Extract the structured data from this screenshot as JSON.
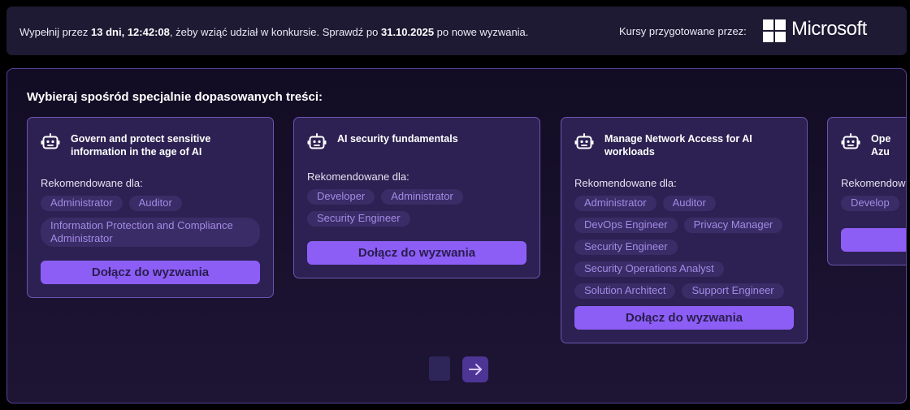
{
  "banner": {
    "text_prefix": "Wypełnij przez ",
    "countdown": "13 dni, 12:42:08",
    "text_middle": ", żeby wziąć udział w konkursie. Sprawdź po ",
    "date": "31.10.2025",
    "text_suffix": " po nowe wyzwania.",
    "courses_by": "Kursy przygotowane przez:",
    "brand": "Microsoft"
  },
  "section_title": "Wybieraj spośród specjalnie dopasowanych treści:",
  "rec_label": "Rekomendowane dla:",
  "join_label": "Dołącz do wyzwania",
  "cards": [
    {
      "title": "Govern and protect sensitive information in the age of AI",
      "tags": [
        "Administrator",
        "Auditor",
        "Information Protection and Compliance Administrator"
      ]
    },
    {
      "title": "AI security fundamentals",
      "tags": [
        "Developer",
        "Administrator",
        "Security Engineer"
      ]
    },
    {
      "title": "Manage Network Access for AI workloads",
      "tags": [
        "Administrator",
        "Auditor",
        "DevOps Engineer",
        "Privacy Manager",
        "Security Engineer",
        "Security Operations Analyst",
        "Solution Architect",
        "Support Engineer"
      ]
    },
    {
      "title": "Ope Azu",
      "tags": [
        "Develop"
      ]
    }
  ],
  "icons": {
    "card_icon": "robot-icon",
    "next": "arrow-right-icon"
  },
  "colors": {
    "accent": "#8c5ef6",
    "card_bg": "#2c2152",
    "tag_text": "#a28ae6"
  }
}
